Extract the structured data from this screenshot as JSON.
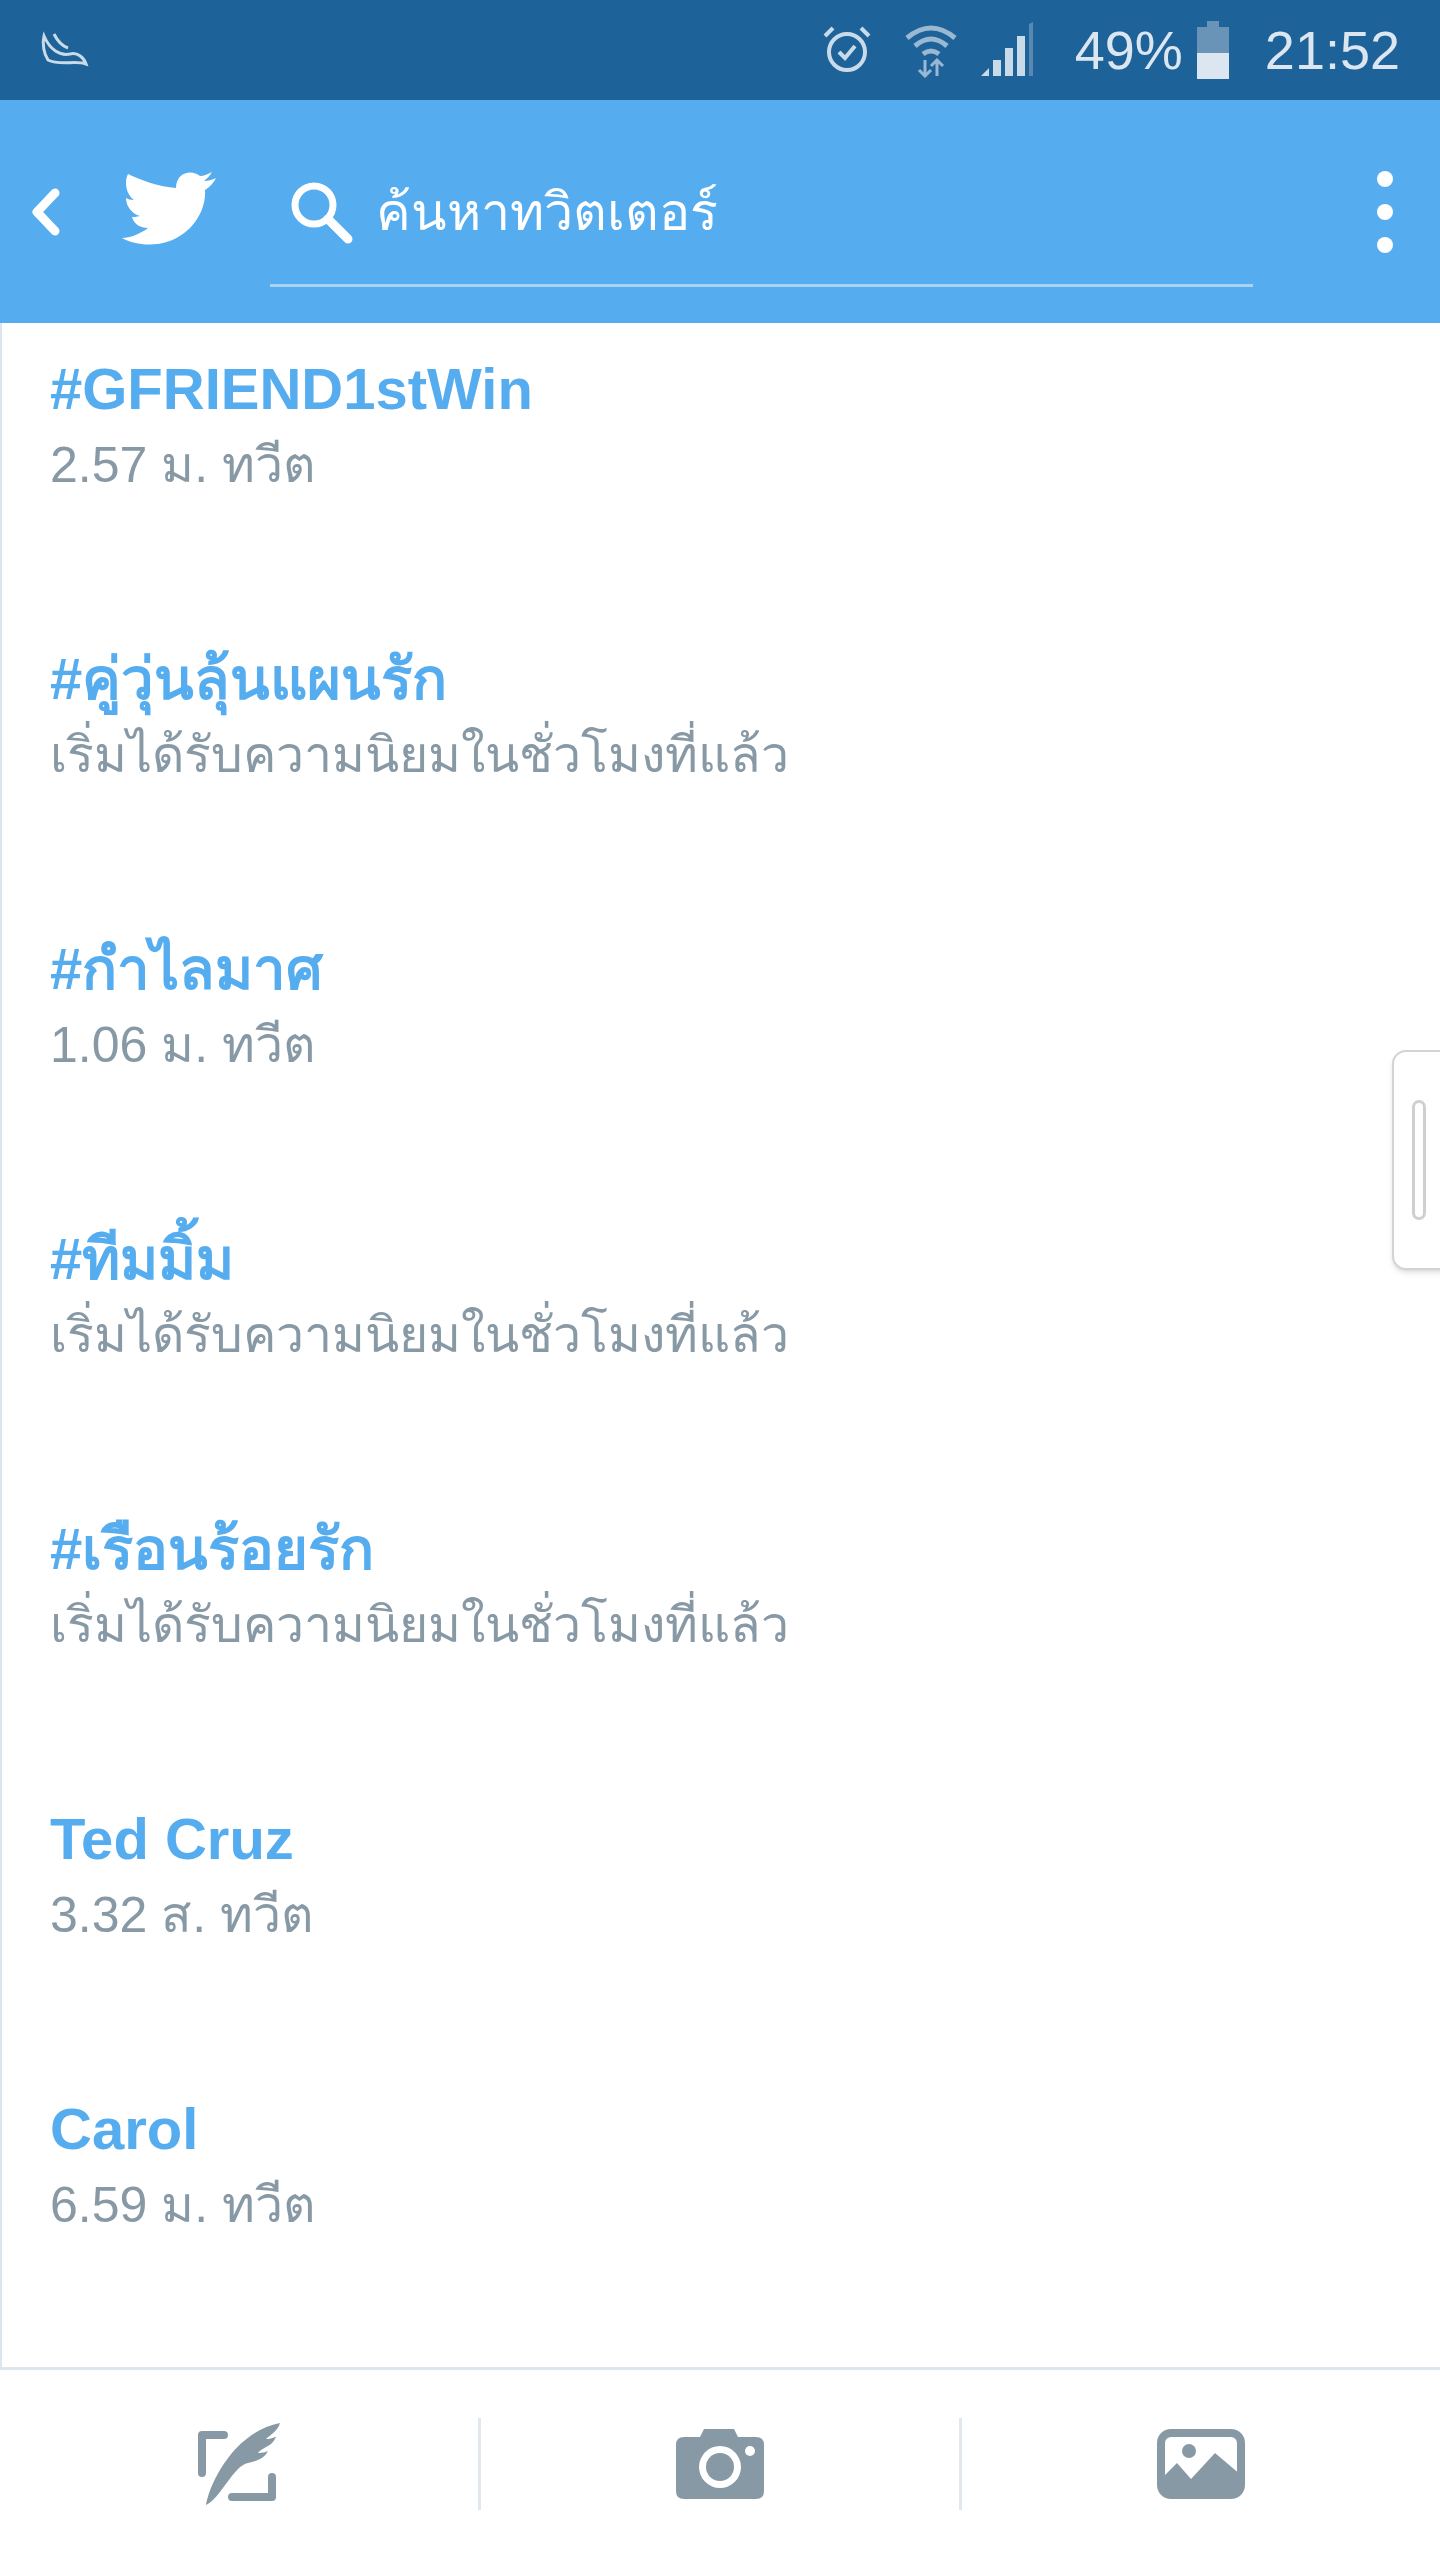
{
  "status_bar": {
    "battery": "49%",
    "time": "21:52"
  },
  "header": {
    "search": {
      "placeholder": "ค้นหาทวิตเตอร์"
    }
  },
  "trends": [
    {
      "title": "#GFRIEND1stWin",
      "subtitle": "2.57 ม. ทวีต"
    },
    {
      "title": "#คู่วุ่นลุ้นแผนรัก",
      "subtitle": "เริ่มได้รับความนิยมในชั่วโมงที่แล้ว"
    },
    {
      "title": "#กำไลมาศ",
      "subtitle": "1.06 ม. ทวีต"
    },
    {
      "title": "#ทีมมิ้ม",
      "subtitle": "เริ่มได้รับความนิยมในชั่วโมงที่แล้ว"
    },
    {
      "title": "#เรือนร้อยรัก",
      "subtitle": "เริ่มได้รับความนิยมในชั่วโมงที่แล้ว"
    },
    {
      "title": "Ted Cruz",
      "subtitle": "3.32 ส. ทวีต"
    },
    {
      "title": "Carol",
      "subtitle": "6.59 ม. ทวีต"
    }
  ]
}
